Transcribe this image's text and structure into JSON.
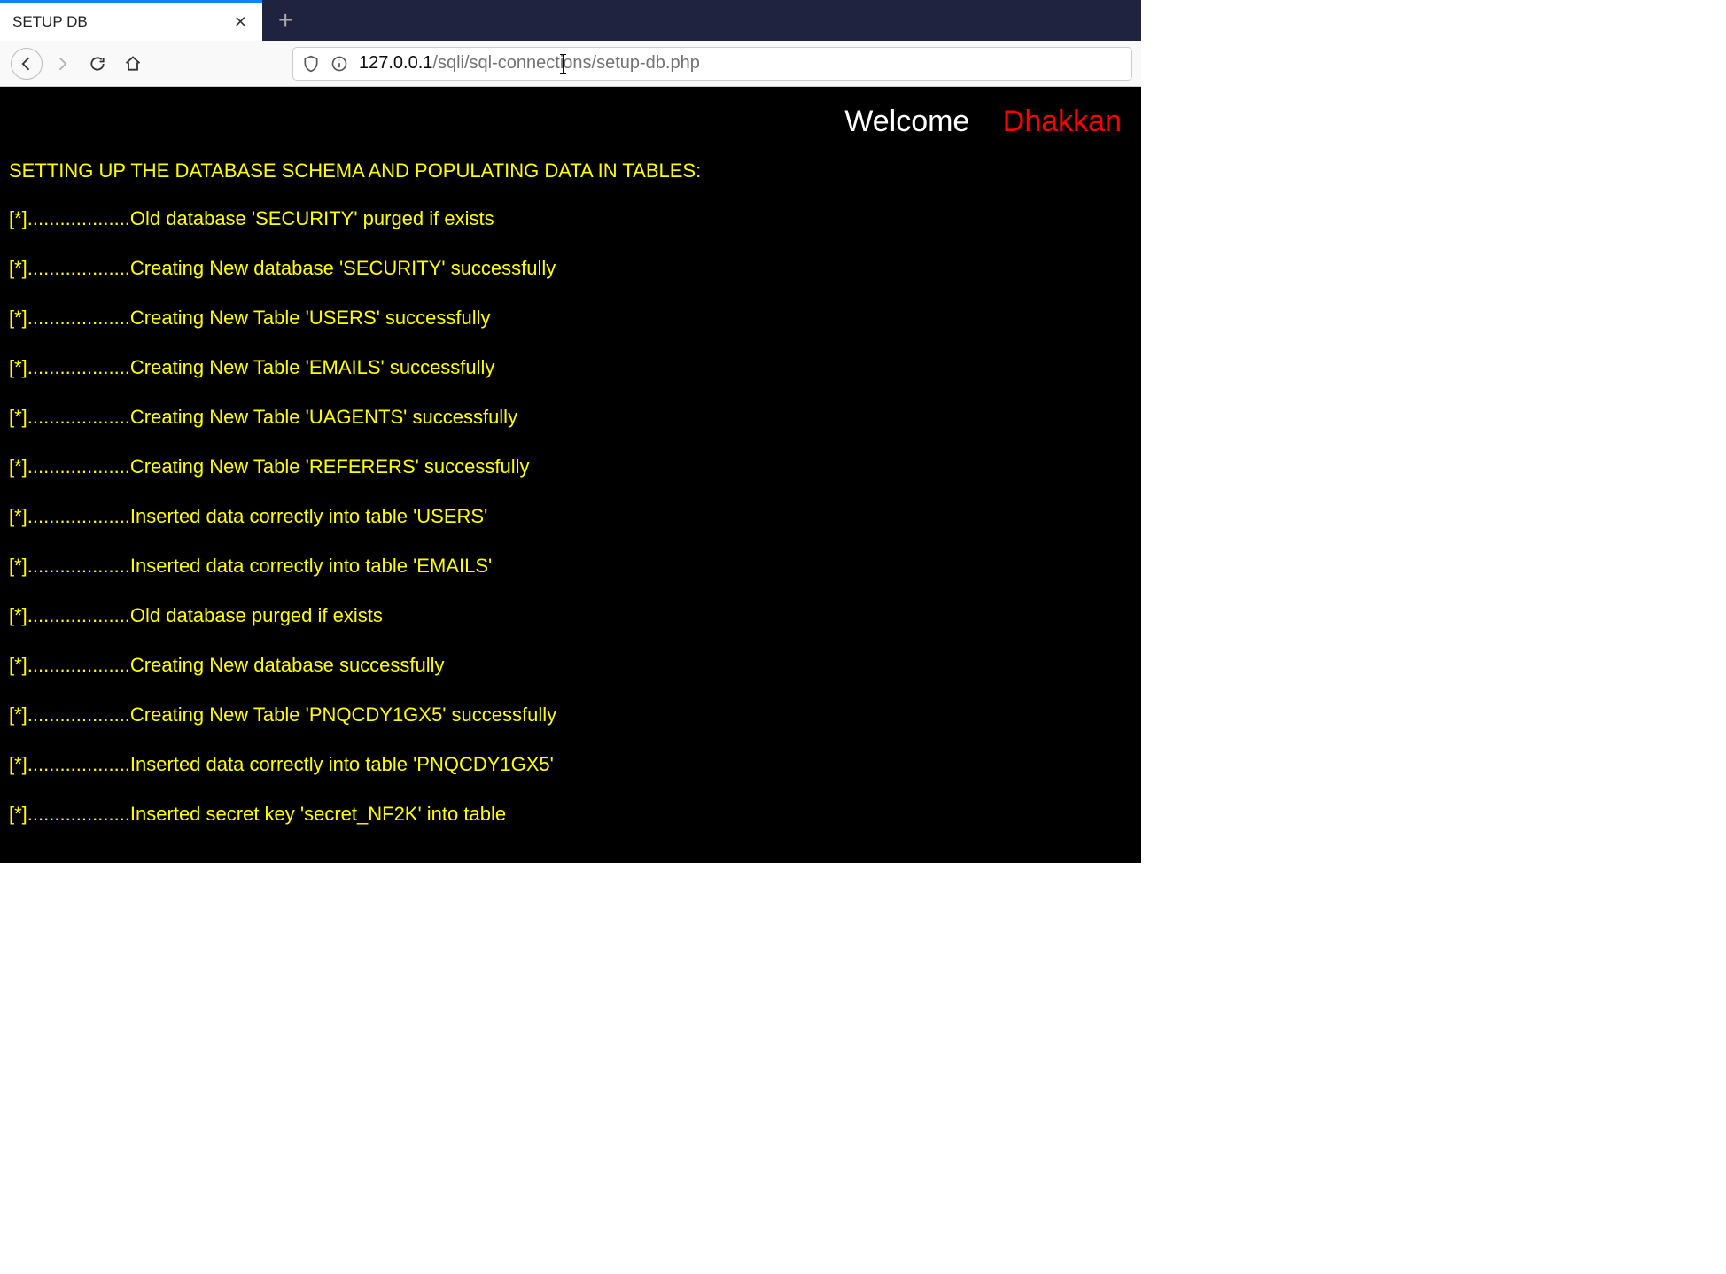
{
  "tab": {
    "title": "SETUP DB"
  },
  "url": {
    "host": "127.0.0.1",
    "path_before_cursor": "/sqli/sql-connecti",
    "path_after_cursor": "ons/setup-db.php"
  },
  "welcome": {
    "text": "Welcome",
    "name": "Dhakkan"
  },
  "heading": "SETTING UP THE DATABASE SCHEMA AND POPULATING DATA IN TABLES:",
  "log_prefix": "[*]...................",
  "log_lines": [
    "Old database 'SECURITY' purged if exists",
    "Creating New database 'SECURITY' successfully",
    "Creating New Table 'USERS' successfully",
    "Creating New Table 'EMAILS' successfully",
    "Creating New Table 'UAGENTS' successfully",
    "Creating New Table 'REFERERS' successfully",
    "Inserted data correctly into table 'USERS'",
    "Inserted data correctly into table 'EMAILS'",
    "Old database purged if exists",
    "Creating New database successfully",
    "Creating New Table 'PNQCDY1GX5' successfully",
    "Inserted data correctly into table 'PNQCDY1GX5'",
    "Inserted secret key 'secret_NF2K' into table"
  ]
}
